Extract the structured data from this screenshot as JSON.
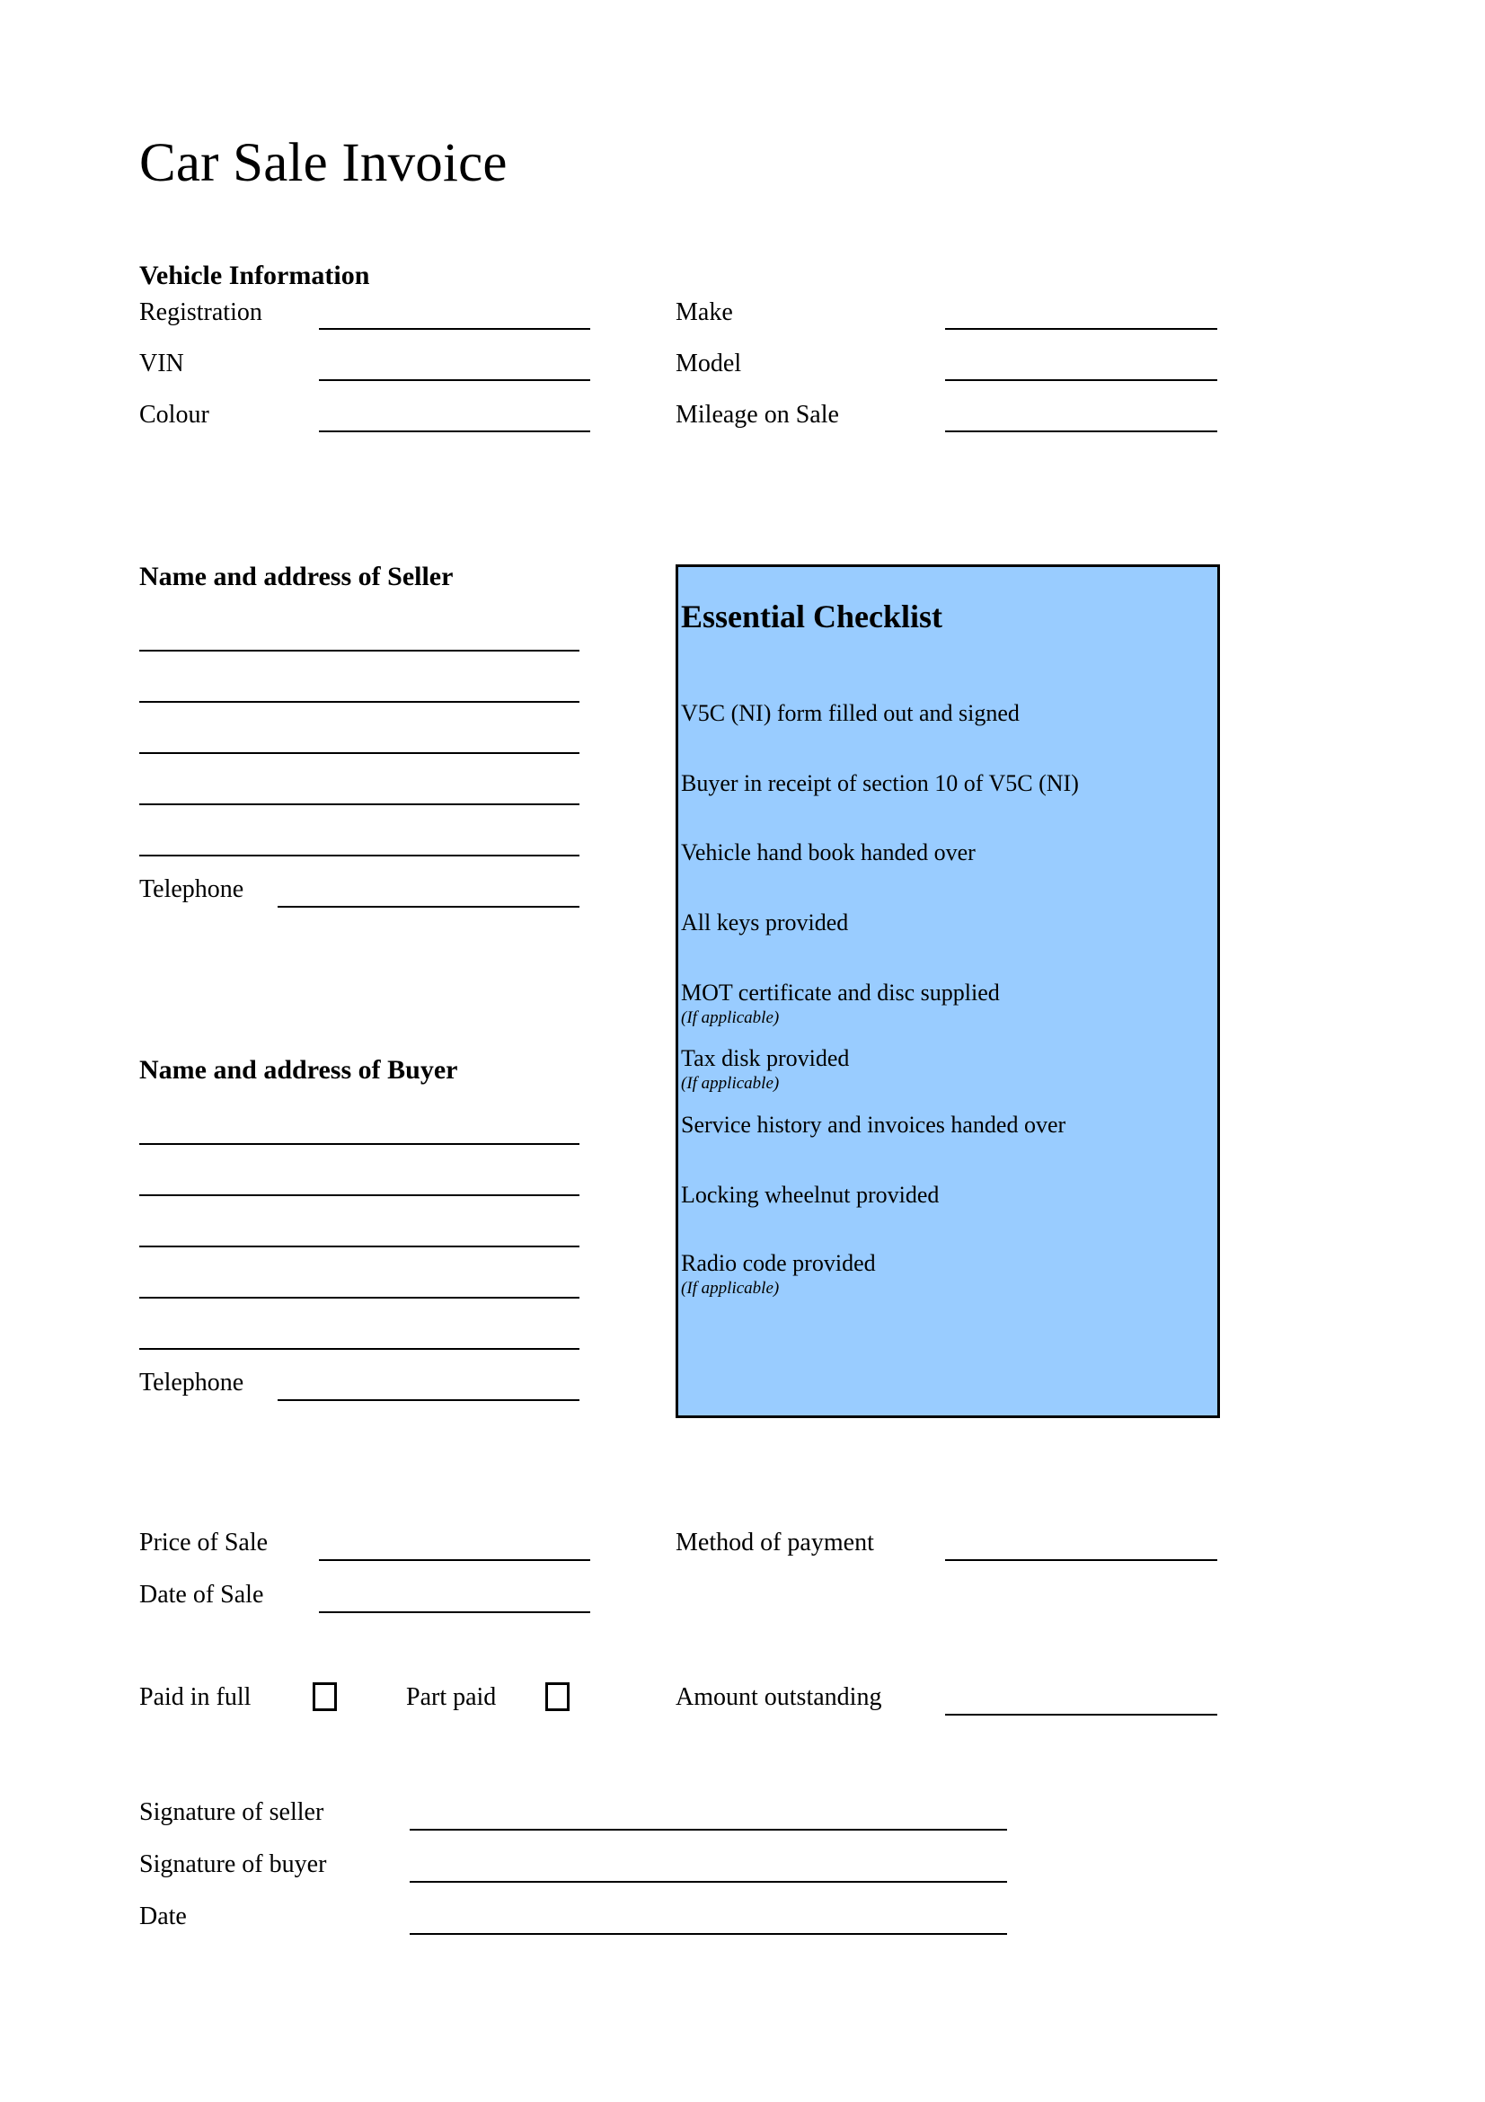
{
  "document": {
    "title": "Car Sale Invoice"
  },
  "vehicle_section": {
    "heading": "Vehicle Information",
    "left_fields": [
      {
        "label": "Registration"
      },
      {
        "label": "VIN"
      },
      {
        "label": "Colour"
      }
    ],
    "right_fields": [
      {
        "label": "Make"
      },
      {
        "label": "Model"
      },
      {
        "label": "Mileage on Sale"
      }
    ]
  },
  "seller_section": {
    "heading": "Name and address of Seller",
    "address_line_count": 5,
    "telephone_label": "Telephone"
  },
  "buyer_section": {
    "heading": "Name and address of Buyer",
    "address_line_count": 5,
    "telephone_label": "Telephone"
  },
  "checklist": {
    "title": "Essential Checklist",
    "fill_color": "#99CCFF",
    "border_color": "#000000",
    "items": [
      {
        "text": "V5C (NI) form filled out and signed",
        "note": ""
      },
      {
        "text": "Buyer in receipt of section 10 of V5C (NI)",
        "note": ""
      },
      {
        "text": "Vehicle hand book handed over",
        "note": ""
      },
      {
        "text": "All keys provided",
        "note": ""
      },
      {
        "text": "MOT certificate and disc supplied",
        "note": "(If applicable)"
      },
      {
        "text": "Tax disk provided",
        "note": "(If applicable)"
      },
      {
        "text": "Service history and invoices handed over",
        "note": ""
      },
      {
        "text": "Locking wheelnut provided",
        "note": ""
      },
      {
        "text": "Radio code provided",
        "note": "(If applicable)"
      }
    ]
  },
  "payment_section": {
    "price_of_sale_label": "Price of Sale",
    "date_of_sale_label": "Date of Sale",
    "method_of_payment_label": "Method of payment",
    "paid_in_full_label": "Paid in full",
    "part_paid_label": "Part paid",
    "amount_outstanding_label": "Amount outstanding",
    "paid_in_full_checked": false,
    "part_paid_checked": false
  },
  "signature_section": {
    "signature_of_seller_label": "Signature of seller",
    "signature_of_buyer_label": "Signature of buyer",
    "date_label": "Date"
  }
}
